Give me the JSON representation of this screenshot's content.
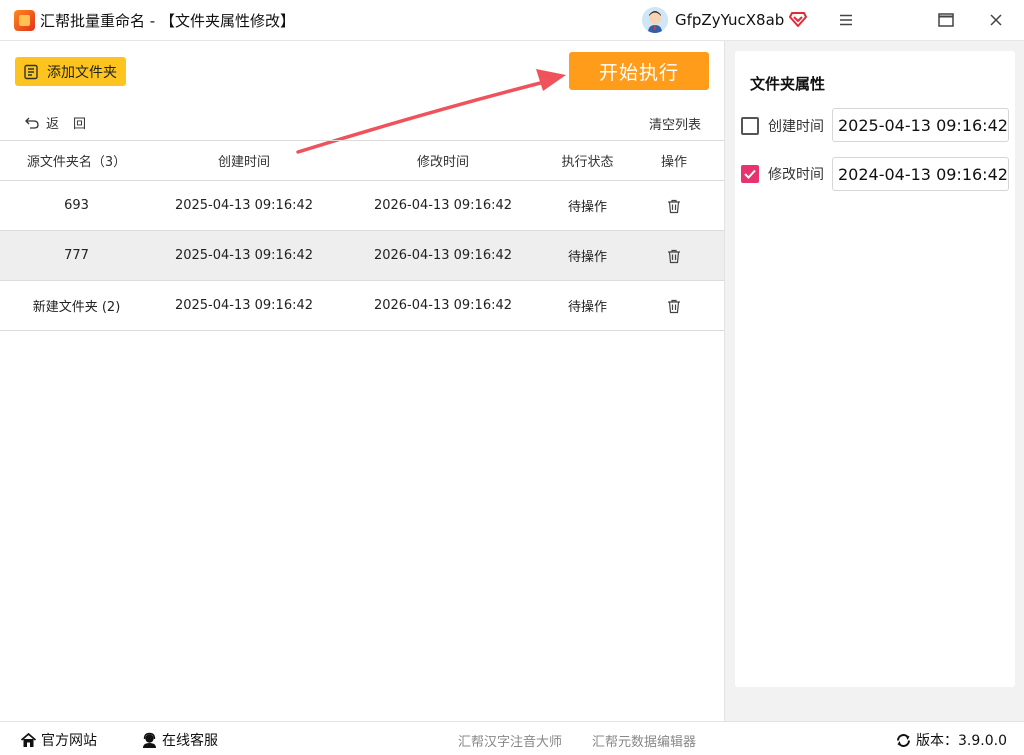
{
  "app": {
    "title": "汇帮批量重命名 - 【文件夹属性修改】",
    "username": "GfpZyYucX8ab"
  },
  "toolbar": {
    "add_folder_label": "添加文件夹",
    "start_label": "开始执行",
    "back_label": "返回",
    "clear_label": "清空列表"
  },
  "table": {
    "headers": [
      "源文件夹名（3）",
      "创建时间",
      "修改时间",
      "执行状态",
      "操作"
    ],
    "rows": [
      {
        "name": "693",
        "created": "2025-04-13 09:16:42",
        "modified": "2026-04-13 09:16:42",
        "status": "待操作"
      },
      {
        "name": "777",
        "created": "2025-04-13 09:16:42",
        "modified": "2026-04-13 09:16:42",
        "status": "待操作"
      },
      {
        "name": "新建文件夹 (2)",
        "created": "2025-04-13 09:16:42",
        "modified": "2026-04-13 09:16:42",
        "status": "待操作"
      }
    ]
  },
  "panel": {
    "title": "文件夹属性",
    "created_label": "创建时间",
    "created_checked": false,
    "created_value": "2025-04-13 09:16:42",
    "modified_label": "修改时间",
    "modified_checked": true,
    "modified_value": "2024-04-13 09:16:42"
  },
  "footer": {
    "website": "官方网站",
    "support": "在线客服",
    "link1": "汇帮汉字注音大师",
    "link2": "汇帮元数据编辑器",
    "version": "版本：3.9.0.0"
  },
  "colors": {
    "accent_orange": "#ff9c1a",
    "button_yellow": "#fdc41f",
    "checkbox_pink": "#e8336f",
    "arrow_red": "#f0525c"
  }
}
